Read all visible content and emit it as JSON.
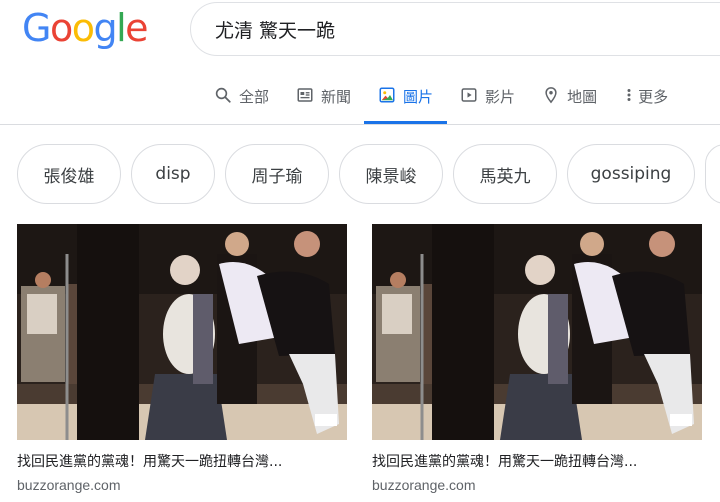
{
  "logo": {
    "text": "Google",
    "letters": [
      {
        "ch": "G",
        "color": "#4285F4"
      },
      {
        "ch": "o",
        "color": "#EA4335"
      },
      {
        "ch": "o",
        "color": "#FBBC05"
      },
      {
        "ch": "g",
        "color": "#4285F4"
      },
      {
        "ch": "l",
        "color": "#34A853"
      },
      {
        "ch": "e",
        "color": "#EA4335"
      }
    ]
  },
  "search": {
    "query": "尤清 驚天一跪"
  },
  "tabs": [
    {
      "label": "全部",
      "icon": "search-icon",
      "active": false
    },
    {
      "label": "新聞",
      "icon": "news-icon",
      "active": false
    },
    {
      "label": "圖片",
      "icon": "image-icon",
      "active": true
    },
    {
      "label": "影片",
      "icon": "video-icon",
      "active": false
    },
    {
      "label": "地圖",
      "icon": "map-pin-icon",
      "active": false
    },
    {
      "label": "更多",
      "icon": "more-vertical-icon",
      "active": false
    }
  ],
  "chips": [
    "張俊雄",
    "disp",
    "周子瑜",
    "陳景峻",
    "馬英九",
    "gossiping"
  ],
  "results": [
    {
      "title": "找回民進黨的黨魂！用驚天一跪扭轉台灣...",
      "source": "buzzorange.com"
    },
    {
      "title": "找回民進黨的黨魂！用驚天一跪扭轉台灣...",
      "source": "buzzorange.com"
    }
  ],
  "colors": {
    "accent": "#1a73e8",
    "muted": "#5f6368",
    "border": "#dadce0"
  }
}
